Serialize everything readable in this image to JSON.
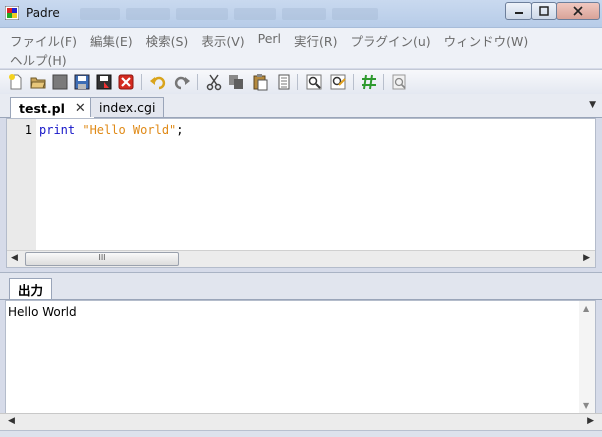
{
  "window": {
    "title": "Padre"
  },
  "menu": {
    "row1": [
      "ファイル(F)",
      "編集(E)",
      "検索(S)",
      "表示(V)",
      "Perl",
      "実行(R)",
      "プラグイン(u)",
      "ウィンドウ(W)"
    ],
    "row2": [
      "ヘルプ(H)"
    ]
  },
  "toolbar": {
    "icons": [
      "new-file-icon",
      "open-file-icon",
      "save-icon",
      "save-as-icon",
      "save-all-icon",
      "close-file-icon",
      "undo-icon",
      "redo-icon",
      "cut-icon",
      "copy-icon",
      "paste-icon",
      "select-all-icon",
      "find-icon",
      "find-replace-icon",
      "comment-toggle-icon",
      "document-stats-icon"
    ]
  },
  "editor": {
    "tabs": [
      {
        "label": "test.pl",
        "active": true
      },
      {
        "label": "index.cgi",
        "active": false
      }
    ],
    "line_number": "1",
    "code": {
      "keyword": "print",
      "space": " ",
      "string": "\"Hello World\"",
      "end": ";"
    },
    "scroll_thumb_label": "III"
  },
  "output": {
    "tab_label": "出力",
    "text": "Hello World"
  },
  "colors": {
    "keyword": "#1515c8",
    "string": "#e08a17"
  }
}
